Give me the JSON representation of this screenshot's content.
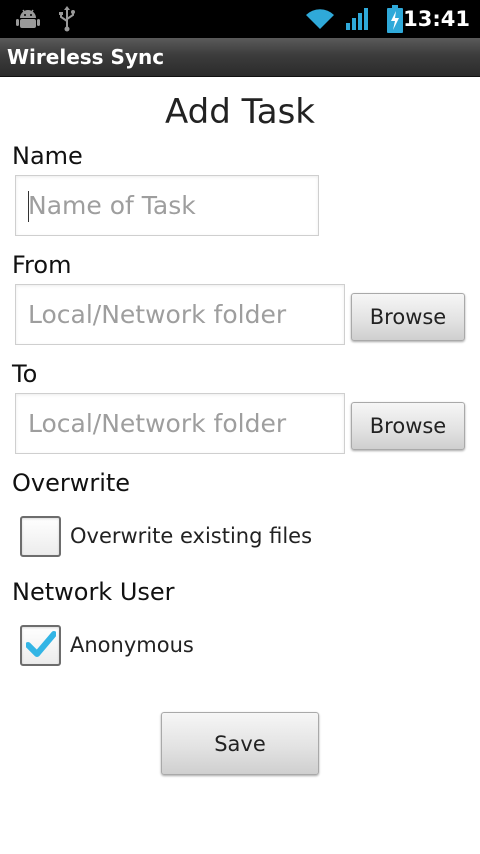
{
  "status_bar": {
    "time": "13:41",
    "icons": [
      "android-debug-icon",
      "usb-icon",
      "wifi-icon",
      "signal-icon",
      "battery-charging-icon"
    ]
  },
  "app": {
    "title": "Wireless Sync"
  },
  "form": {
    "heading": "Add Task",
    "name": {
      "label": "Name",
      "value": "",
      "placeholder": "Name of Task"
    },
    "from": {
      "label": "From",
      "value": "",
      "placeholder": "Local/Network folder",
      "browse_label": "Browse"
    },
    "to": {
      "label": "To",
      "value": "",
      "placeholder": "Local/Network folder",
      "browse_label": "Browse"
    },
    "overwrite": {
      "label": "Overwrite",
      "checkbox_label": "Overwrite existing files",
      "checked": false
    },
    "network_user": {
      "label": "Network User",
      "checkbox_label": "Anonymous",
      "checked": true
    },
    "save_label": "Save"
  },
  "colors": {
    "accent_check": "#33b5e5",
    "status_bar": "#000000",
    "title_bar": "#3c3c3c"
  }
}
